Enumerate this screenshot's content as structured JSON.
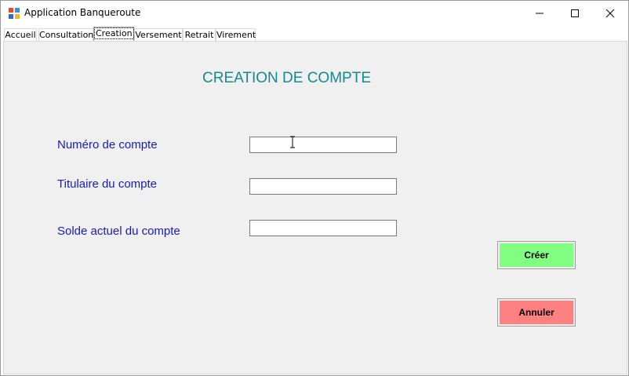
{
  "window": {
    "title": "Application Banqueroute"
  },
  "tabs": [
    {
      "label": "Accueil"
    },
    {
      "label": "Consultation"
    },
    {
      "label": "Creation"
    },
    {
      "label": "Versement"
    },
    {
      "label": "Retrait"
    },
    {
      "label": "Virement"
    }
  ],
  "active_tab": "Creation",
  "form": {
    "heading": "CREATION DE COMPTE",
    "numero_label": "Numéro de compte",
    "numero_value": "",
    "titulaire_label": "Titulaire du compte",
    "titulaire_value": "",
    "solde_label": "Solde actuel du compte",
    "solde_value": ""
  },
  "buttons": {
    "creer": "Créer",
    "annuler": "Annuler"
  },
  "colors": {
    "heading": "#148a8f",
    "labels": "#1a1ab8",
    "creer_bg": "#80ff80",
    "annuler_bg": "#ff8080"
  }
}
